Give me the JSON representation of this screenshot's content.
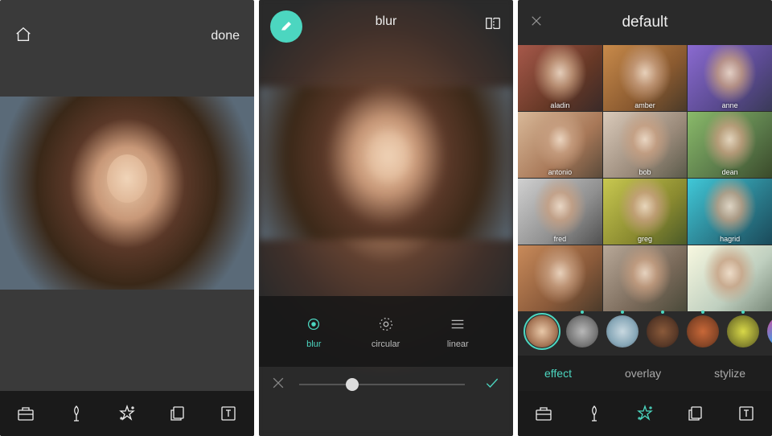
{
  "screen1": {
    "done_label": "done",
    "tools": [
      "toolbox",
      "pen",
      "effects",
      "layers",
      "text"
    ]
  },
  "screen2": {
    "title": "blur",
    "modes": [
      {
        "id": "blur",
        "label": "blur",
        "active": true
      },
      {
        "id": "circular",
        "label": "circular",
        "active": false
      },
      {
        "id": "linear",
        "label": "linear",
        "active": false
      }
    ],
    "slider_value": 32
  },
  "screen3": {
    "title": "default",
    "filters": [
      {
        "name": "aladin",
        "tint": "linear-gradient(135deg,#a6584a 0%,#663826 60%,#3a2a28 100%)"
      },
      {
        "name": "amber",
        "tint": "linear-gradient(135deg,#c88a4a 0%,#8a5a30 60%,#4a3a28 100%)"
      },
      {
        "name": "anne",
        "tint": "linear-gradient(135deg,#8a6ad0 0%,#5a4a90 60%,#3a3a58 100%)"
      },
      {
        "name": "antonio",
        "tint": "linear-gradient(135deg,#d8b898 0%,#a87858 60%,#5a4a3a 100%)"
      },
      {
        "name": "bob",
        "tint": "linear-gradient(135deg,#dacaba 0%,#9a8a7a 60%,#5a5a4a 100%)"
      },
      {
        "name": "dean",
        "tint": "linear-gradient(135deg,#8aba6a 0%,#5a7a4a 60%,#3a4a2a 100%)"
      },
      {
        "name": "fred",
        "tint": "linear-gradient(135deg,#d0d0d0 0%,#909090 60%,#505050 100%)"
      },
      {
        "name": "greg",
        "tint": "linear-gradient(135deg,#c8c850 0%,#8a8a30 60%,#4a5a28 100%)"
      },
      {
        "name": "hagrid",
        "tint": "linear-gradient(135deg,#40c8d8 0%,#2a7a8a 60%,#1a4a5a 100%)"
      },
      {
        "name": "",
        "tint": "linear-gradient(135deg,#c88a5a 0%,#8a5a3a 60%,#4a3a2a 100%)"
      },
      {
        "name": "",
        "tint": "linear-gradient(135deg,#b8a898 0%,#7a6a5a 60%,#4a4a3a 100%)"
      },
      {
        "name": "",
        "tint": "linear-gradient(135deg,#f8f8e0 0%,#c0d0c0 60%,#7a8a7a 100%)"
      }
    ],
    "categories": [
      {
        "tint": "radial-gradient(circle,#e8c8a8 0%,#a87858 60%,#5a3a28 100%)",
        "selected": true,
        "dot": false
      },
      {
        "tint": "radial-gradient(circle,#b8b8b8 0%,#787878 60%,#3a3a3a 100%)",
        "selected": false,
        "dot": true
      },
      {
        "tint": "radial-gradient(circle,#c8d8e0 0%,#88a8b8 60%,#4a5a68 100%)",
        "selected": false,
        "dot": true
      },
      {
        "tint": "radial-gradient(circle,#8a5a3a 0%,#5a3a28 60%,#2a1a18 100%)",
        "selected": false,
        "dot": true
      },
      {
        "tint": "radial-gradient(circle,#c86838 0%,#8a4828 60%,#4a2818 100%)",
        "selected": false,
        "dot": true
      },
      {
        "tint": "radial-gradient(circle,#d8d848 0%,#8a8a30 60%,#4a4a20 100%)",
        "selected": false,
        "dot": true
      },
      {
        "tint": "linear-gradient(135deg,#e04898 0%,#4898e0 50%,#48e098 100%)",
        "selected": false,
        "dot": true
      }
    ],
    "tabs": [
      {
        "id": "effect",
        "label": "effect",
        "active": true
      },
      {
        "id": "overlay",
        "label": "overlay",
        "active": false
      },
      {
        "id": "stylize",
        "label": "stylize",
        "active": false
      }
    ],
    "tools": [
      "toolbox",
      "pen",
      "effects",
      "layers",
      "text"
    ],
    "active_tool": "effects"
  }
}
